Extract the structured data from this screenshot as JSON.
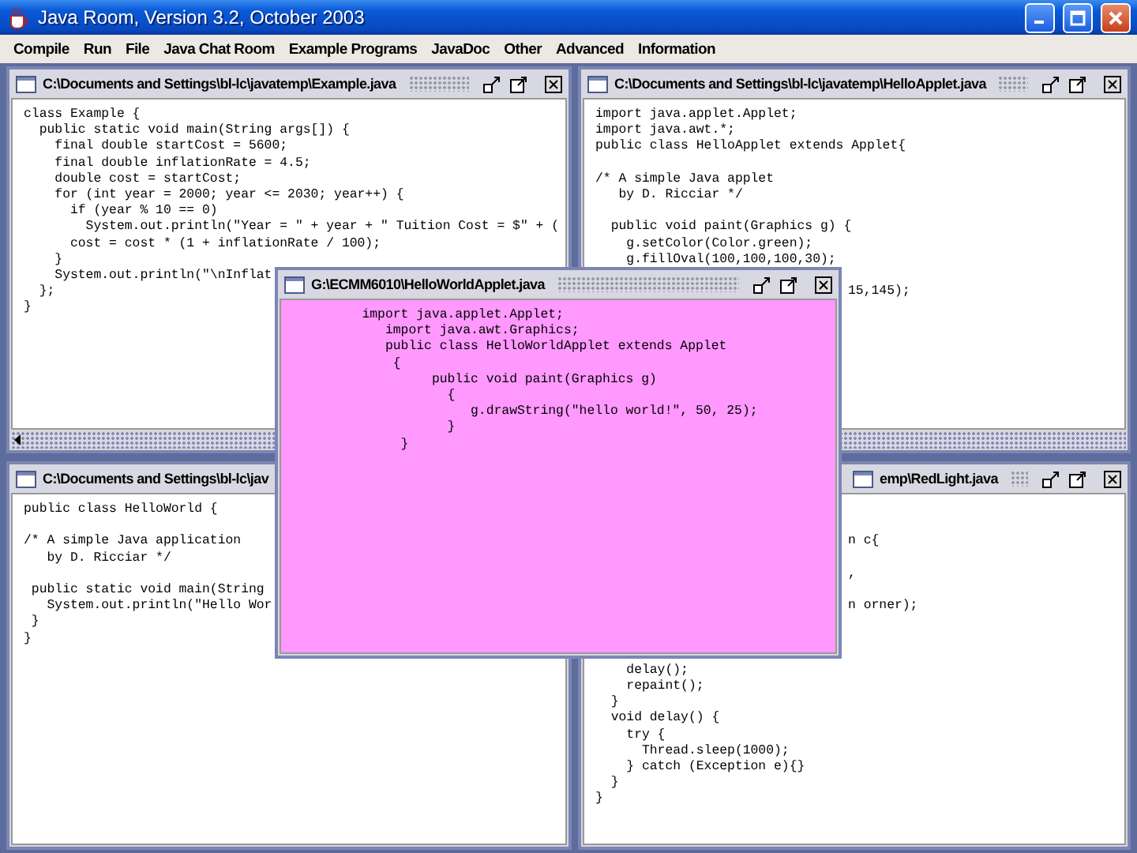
{
  "window": {
    "title": "Java Room, Version 3.2, October 2003"
  },
  "menu": [
    "Compile",
    "Run",
    "File",
    "Java Chat Room",
    "Example Programs",
    "JavaDoc",
    "Other",
    "Advanced",
    "Information"
  ],
  "frames": [
    {
      "title": "C:\\Documents and Settings\\bl-lc\\javatemp\\Example.java",
      "color": "#ffffff",
      "horizontal_scrollbar": true,
      "lines": [
        "class Example {",
        "  public static void main(String args[]) {",
        "    final double startCost = 5600;",
        "    final double inflationRate = 4.5;",
        "    double cost = startCost;",
        "    for (int year = 2000; year <= 2030; year++) {",
        "      if (year % 10 == 0)",
        "        System.out.println(\"Year = \" + year + \" Tuition Cost = $\" + (",
        "      cost = cost * (1 + inflationRate / 100);",
        "    }",
        "    System.out.println(\"\\nInflat",
        "  };",
        "}"
      ]
    },
    {
      "title": "C:\\Documents and Settings\\bl-lc\\javatemp\\HelloApplet.java",
      "color": "#ffffff",
      "horizontal_scrollbar": true,
      "lines": [
        "import java.applet.Applet;",
        "import java.awt.*;",
        "public class HelloApplet extends Applet{",
        {
          "kind": "gap"
        },
        "/* A simple Java applet",
        "   by D. Ricciar */",
        {
          "kind": "gap"
        },
        "  public void paint(Graphics g) {",
        "    g.setColor(Color.green);",
        "    g.fillOval(100,100,100,30);",
        {
          "kind": "gap"
        },
        {
          "kind": "tail",
          "text": "15,145);"
        }
      ]
    },
    {
      "title": "C:\\Documents and Settings\\bl-lc\\jav",
      "color": "#ffffff",
      "horizontal_scrollbar": false,
      "lines": [
        "public class HelloWorld {",
        {
          "kind": "gap"
        },
        "/* A simple Java application",
        "   by D. Ricciar */",
        {
          "kind": "gap"
        },
        " public static void main(String",
        "   System.out.println(\"Hello Wor",
        " }",
        "}"
      ]
    },
    {
      "title": "emp\\RedLight.java",
      "color": "#ffffff",
      "horizontal_scrollbar": false,
      "lines": [
        {
          "kind": "gap"
        },
        {
          "kind": "gap"
        },
        {
          "kind": "tail",
          "text": "n c{"
        },
        {
          "kind": "gap"
        },
        {
          "kind": "tail",
          "text": ","
        },
        {
          "kind": "gap"
        },
        {
          "kind": "tail",
          "text": "n orner);"
        },
        {
          "kind": "gap"
        },
        {
          "kind": "gap"
        },
        {
          "kind": "gap"
        },
        "    delay();",
        "    repaint();",
        "  }",
        "  void delay() {",
        "    try {",
        "      Thread.sleep(1000);",
        "    } catch (Exception e){}",
        "  }",
        "}"
      ]
    },
    {
      "title": "G:\\ECMM6010\\HelloWorldApplet.java",
      "color": "#ff99ff",
      "horizontal_scrollbar": false,
      "lines": [
        "         import java.applet.Applet;",
        "            import java.awt.Graphics;",
        "            public class HelloWorldApplet extends Applet",
        "             {",
        "                  public void paint(Graphics g)",
        "                    {",
        "                       g.drawString(\"hello world!\", 50, 25);",
        "                    }",
        "              }"
      ]
    }
  ]
}
